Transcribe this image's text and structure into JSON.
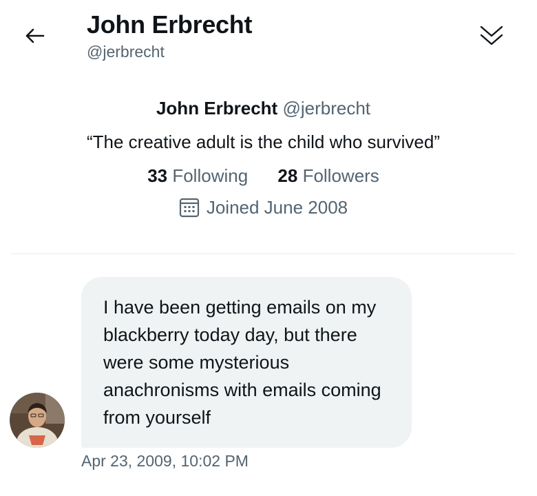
{
  "header": {
    "title": "John Erbrecht",
    "handle": "@jerbrecht",
    "back_icon": "back-arrow-icon",
    "collapse_icon": "double-chevron-down-icon"
  },
  "profile": {
    "name": "John Erbrecht",
    "handle": "@jerbrecht",
    "bio": "“The creative adult is the child who survived”",
    "following_count": "33",
    "following_label": "Following",
    "followers_count": "28",
    "followers_label": "Followers",
    "joined_icon": "calendar-icon",
    "joined": "Joined June 2008"
  },
  "message": {
    "text": "I have been getting emails on my blackberry today day, but there were some mysterious anachronisms with emails coming from yourself",
    "timestamp": "Apr 23, 2009, 10:02 PM",
    "bubble_color": "#eff3f4"
  },
  "colors": {
    "text_primary": "#0f1419",
    "text_secondary": "#536471"
  }
}
